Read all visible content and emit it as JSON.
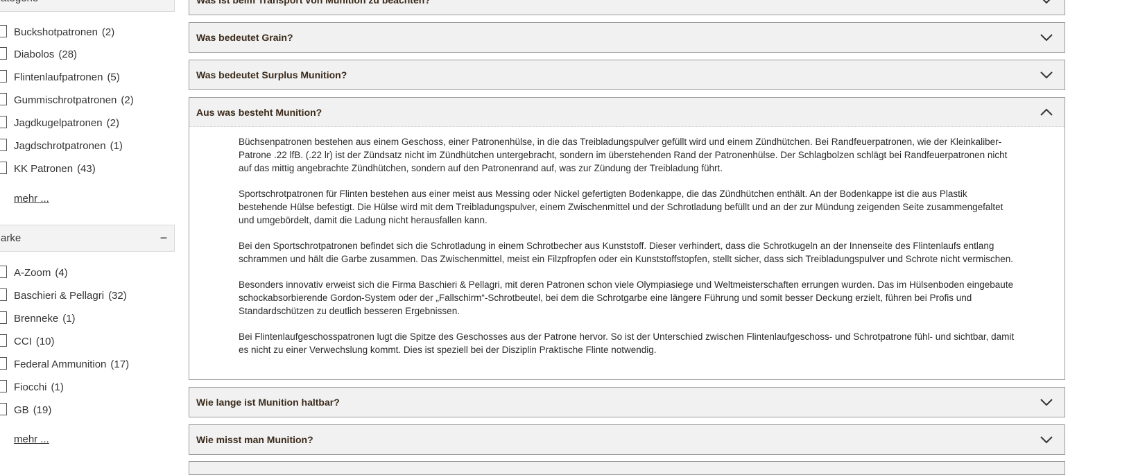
{
  "sidebar": {
    "category": {
      "title": "ategorie",
      "items": [
        {
          "label": "Buckshotpatronen",
          "count": "(2)"
        },
        {
          "label": "Diabolos",
          "count": "(28)"
        },
        {
          "label": "Flintenlaufpatronen",
          "count": "(5)"
        },
        {
          "label": "Gummischrotpatronen",
          "count": "(2)"
        },
        {
          "label": "Jagdkugelpatronen",
          "count": "(2)"
        },
        {
          "label": "Jagdschrotpatronen",
          "count": "(1)"
        },
        {
          "label": "KK Patronen",
          "count": "(43)"
        }
      ],
      "more": "mehr ..."
    },
    "brand": {
      "title": "arke",
      "toggle": "−",
      "items": [
        {
          "label": "A-Zoom",
          "count": "(4)"
        },
        {
          "label": "Baschieri & Pellagri",
          "count": "(32)"
        },
        {
          "label": "Brenneke",
          "count": "(1)"
        },
        {
          "label": "CCI",
          "count": "(10)"
        },
        {
          "label": "Federal Ammunition",
          "count": "(17)"
        },
        {
          "label": "Fiocchi",
          "count": "(1)"
        },
        {
          "label": "GB",
          "count": "(19)"
        }
      ],
      "more": "mehr ..."
    }
  },
  "faq": {
    "items": [
      {
        "question": "Was ist beim Transport von Munition zu beachten?",
        "open": false,
        "icon": "chevron-down-icon"
      },
      {
        "question": "Was bedeutet Grain?",
        "open": false,
        "icon": "chevron-down-icon"
      },
      {
        "question": "Was bedeutet Surplus Munition?",
        "open": false,
        "icon": "chevron-down-icon"
      },
      {
        "question": "Aus was besteht Munition?",
        "open": true,
        "icon": "chevron-up-icon",
        "paragraphs": [
          "Büchsenpatronen bestehen aus einem Geschoss, einer Patronenhülse, in die das Treibladungspulver gefüllt wird und einem Zündhütchen. Bei Randfeuerpatronen, wie der Kleinkaliber-Patrone .22 lfB. (.22 lr) ist der Zündsatz nicht im Zündhütchen untergebracht, sondern im überstehenden Rand der Patronenhülse. Der Schlagbolzen schlägt bei Randfeuerpatronen nicht auf das mittig angebrachte Zündhütchen, sondern auf den Patronenrand auf, was zur Zündung der Treibladung führt.",
          "Sportschrotpatronen für Flinten bestehen aus einer meist aus Messing oder Nickel gefertigten Bodenkappe, die das Zündhütchen enthält. An der Bodenkappe ist die aus Plastik bestehende Hülse befestigt. Die Hülse wird mit dem Treibladungspulver, einem Zwischenmittel und der Schrotladung befüllt und an der zur Mündung zeigenden Seite zusammengefaltet und umgebördelt, damit die Ladung nicht herausfallen kann.",
          "Bei den Sportschrotpatronen befindet sich die Schrotladung in einem Schrotbecher aus Kunststoff. Dieser verhindert, dass die Schrotkugeln an der Innenseite des Flintenlaufs entlang schrammen und hält die Garbe zusammen. Das Zwischenmittel, meist ein Filzpfropfen oder ein Kunststoffstopfen, stellt sicher, dass sich Treibladungspulver und Schrote nicht vermischen.",
          "Besonders innovativ erweist sich die Firma Baschieri & Pellagri, mit deren Patronen schon viele Olympiasiege und Weltmeisterschaften errungen wurden. Das im Hülsenboden eingebaute schockabsorbierende Gordon-System oder der „Fallschirm“-Schrotbeutel, bei dem die Schrotgarbe eine längere Führung und somit besser Deckung erzielt, führen bei Profis und Standardschützen zu deutlich besseren Ergebnissen.",
          "Bei Flintenlaufgeschosspatronen lugt die Spitze des Geschosses aus der Patrone hervor. So ist der Unterschied zwischen Flintenlaufgeschoss- und Schrotpatrone fühl- und sichtbar, damit es nicht zu einer Verwechslung kommt. Dies ist speziell bei der Disziplin Praktische Flinte notwendig."
        ]
      },
      {
        "question": "Wie lange ist Munition haltbar?",
        "open": false,
        "icon": "chevron-down-icon"
      },
      {
        "question": "Wie misst man Munition?",
        "open": false,
        "icon": "chevron-down-icon"
      }
    ]
  }
}
